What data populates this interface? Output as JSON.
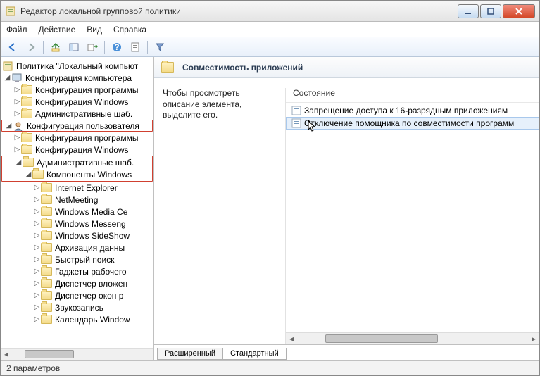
{
  "window": {
    "title": "Редактор локальной групповой политики"
  },
  "menu": {
    "file": "Файл",
    "action": "Действие",
    "view": "Вид",
    "help": "Справка"
  },
  "tree": {
    "root": "Политика \"Локальный компьют",
    "computer_config": "Конфигурация компьютера",
    "cc_prog": "Конфигурация программы",
    "cc_win": "Конфигурация Windows",
    "cc_adm": "Административные шаб.",
    "user_config": "Конфигурация пользователя",
    "uc_prog": "Конфигурация программы",
    "uc_win": "Конфигурация Windows",
    "uc_adm": "Административные шаб.",
    "components": "Компоненты Windows",
    "items": [
      "Internet Explorer",
      "NetMeeting",
      "Windows Media Ce",
      "Windows Messeng",
      "Windows SideShow",
      "Архивация данны",
      "Быстрый поиск",
      "Гаджеты рабочего",
      "Диспетчер вложен",
      "Диспетчер окон р",
      "Звукозапись",
      "Календарь Window"
    ]
  },
  "right": {
    "header": "Совместимость приложений",
    "desc": "Чтобы просмотреть описание элемента, выделите его.",
    "col_state": "Состояние",
    "items": [
      "Запрещение доступа к 16-разрядным приложениям",
      "Отключение помощника по совместимости программ"
    ]
  },
  "tabs": {
    "extended": "Расширенный",
    "standard": "Стандартный"
  },
  "status": "2 параметров"
}
